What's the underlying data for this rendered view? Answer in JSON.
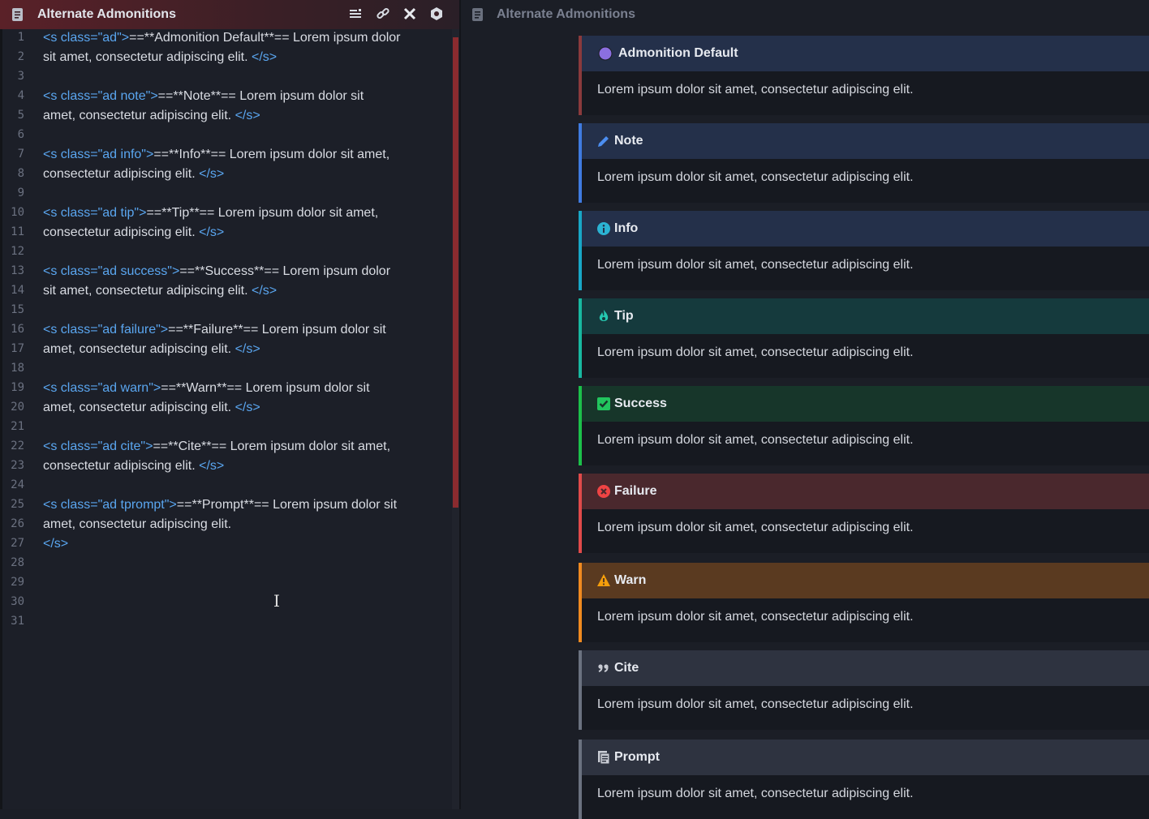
{
  "editor": {
    "title": "Alternate Admonitions",
    "line_numbers": [
      "1",
      "2",
      "3",
      "4",
      "5",
      "6",
      "7",
      "8",
      "9",
      "10",
      "11",
      "12",
      "13",
      "14",
      "15",
      "16",
      "17",
      "18",
      "19",
      "20",
      "21",
      "22",
      "23",
      "24",
      "25",
      "26",
      "27",
      "28",
      "29",
      "30",
      "31"
    ],
    "lines": [
      {
        "open": "<s class=\"ad\">",
        "text": "==**Admonition Default**==  Lorem ipsum dolor",
        "cont": "sit amet, consectetur adipiscing elit. ",
        "close": "</s>"
      },
      {
        "open": "<s class=\"ad note\">",
        "text": "==**Note**==  Lorem ipsum dolor sit",
        "cont": "amet, consectetur adipiscing elit. ",
        "close": "</s>"
      },
      {
        "open": "<s class=\"ad info\">",
        "text": "==**Info**==  Lorem ipsum dolor sit amet,",
        "cont": "consectetur adipiscing elit. ",
        "close": "</s>"
      },
      {
        "open": "<s class=\"ad tip\">",
        "text": "==**Tip**==  Lorem ipsum dolor sit amet,",
        "cont": "consectetur adipiscing elit. ",
        "close": "</s>"
      },
      {
        "open": "<s class=\"ad success\">",
        "text": "==**Success**==  Lorem ipsum dolor",
        "cont": "sit amet, consectetur adipiscing elit. ",
        "close": "</s>"
      },
      {
        "open": "<s class=\"ad failure\">",
        "text": "==**Failure**==  Lorem ipsum dolor sit",
        "cont": "amet, consectetur adipiscing elit. ",
        "close": "</s>"
      },
      {
        "open": "<s class=\"ad warn\">",
        "text": "==**Warn**==  Lorem ipsum dolor sit",
        "cont": "amet, consectetur adipiscing elit. ",
        "close": "</s>"
      },
      {
        "open": "<s class=\"ad cite\">",
        "text": "==**Cite**==  Lorem ipsum dolor sit amet,",
        "cont": "consectetur adipiscing elit. ",
        "close": "</s>"
      },
      {
        "open": "<s class=\"ad tprompt\">",
        "text": "==**Prompt**==  Lorem ipsum dolor sit",
        "cont": "amet, consectetur adipiscing elit.",
        "close": "</s>"
      }
    ],
    "icons": [
      "list-icon",
      "link-icon",
      "close-icon",
      "settings-hex-icon"
    ]
  },
  "preview": {
    "title": "Alternate Admonitions",
    "admonitions": [
      {
        "title": "Admonition Default",
        "body": "Lorem ipsum dolor sit amet, consectetur adipiscing elit.",
        "icon": "circle-icon",
        "accent": "#8a3a3c",
        "head_bg": "#24304a",
        "icon_color": "#8b6fe0"
      },
      {
        "title": "Note",
        "body": "Lorem ipsum dolor sit amet, consectetur adipiscing elit.",
        "icon": "pencil-icon",
        "accent": "#3f7be0",
        "head_bg": "#24304a",
        "icon_color": "#4c8ef0"
      },
      {
        "title": "Info",
        "body": "Lorem ipsum dolor sit amet, consectetur adipiscing elit.",
        "icon": "info-icon",
        "accent": "#18a7c6",
        "head_bg": "#24304a",
        "icon_color": "#2bb3d3"
      },
      {
        "title": "Tip",
        "body": "Lorem ipsum dolor sit amet, consectetur adipiscing elit.",
        "icon": "flame-icon",
        "accent": "#18b8a0",
        "head_bg": "#153a3d",
        "icon_color": "#25c8b0"
      },
      {
        "title": "Success",
        "body": "Lorem ipsum dolor sit amet, consectetur adipiscing elit.",
        "icon": "check-square-icon",
        "accent": "#1cc04a",
        "head_bg": "#17362a",
        "icon_color": "#22c55e"
      },
      {
        "title": "Failure",
        "body": "Lorem ipsum dolor sit amet, consectetur adipiscing elit.",
        "icon": "x-circle-icon",
        "accent": "#e04a4a",
        "head_bg": "#4a282d",
        "icon_color": "#ef4444"
      },
      {
        "title": "Warn",
        "body": "Lorem ipsum dolor sit amet, consectetur adipiscing elit.",
        "icon": "warning-icon",
        "accent": "#f08a20",
        "head_bg": "#5a3a20",
        "icon_color": "#f59e0b"
      },
      {
        "title": "Cite",
        "body": "Lorem ipsum dolor sit amet, consectetur adipiscing elit.",
        "icon": "quote-icon",
        "accent": "#6b7280",
        "head_bg": "#2e3340",
        "icon_color": "#c9ccd4"
      },
      {
        "title": "Prompt",
        "body": "Lorem ipsum dolor sit amet, consectetur adipiscing elit.",
        "icon": "document-icon",
        "accent": "#6b7280",
        "head_bg": "#2e3340",
        "icon_color": "#c9ccd4"
      }
    ]
  }
}
